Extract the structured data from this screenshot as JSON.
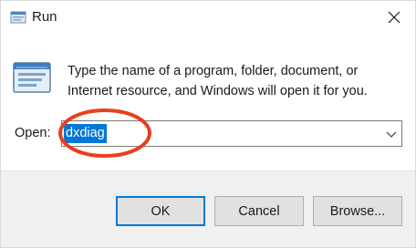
{
  "window": {
    "title": "Run",
    "close_icon": "close-icon"
  },
  "content": {
    "icon": "run-app-icon",
    "description": "Type the name of a program, folder, document, or Internet resource, and Windows will open it for you.",
    "open_label": "Open:",
    "input_value": "dxdiag",
    "input_selected": true,
    "dropdown_icon": "chevron-down-icon",
    "annotation": "red-highlight-ring"
  },
  "buttons": {
    "ok": "OK",
    "cancel": "Cancel",
    "browse": "Browse..."
  },
  "colors": {
    "accent": "#0078d7",
    "highlight_ring": "#e8401c",
    "footer_bg": "#f0f0f0",
    "button_bg": "#e1e1e1"
  }
}
